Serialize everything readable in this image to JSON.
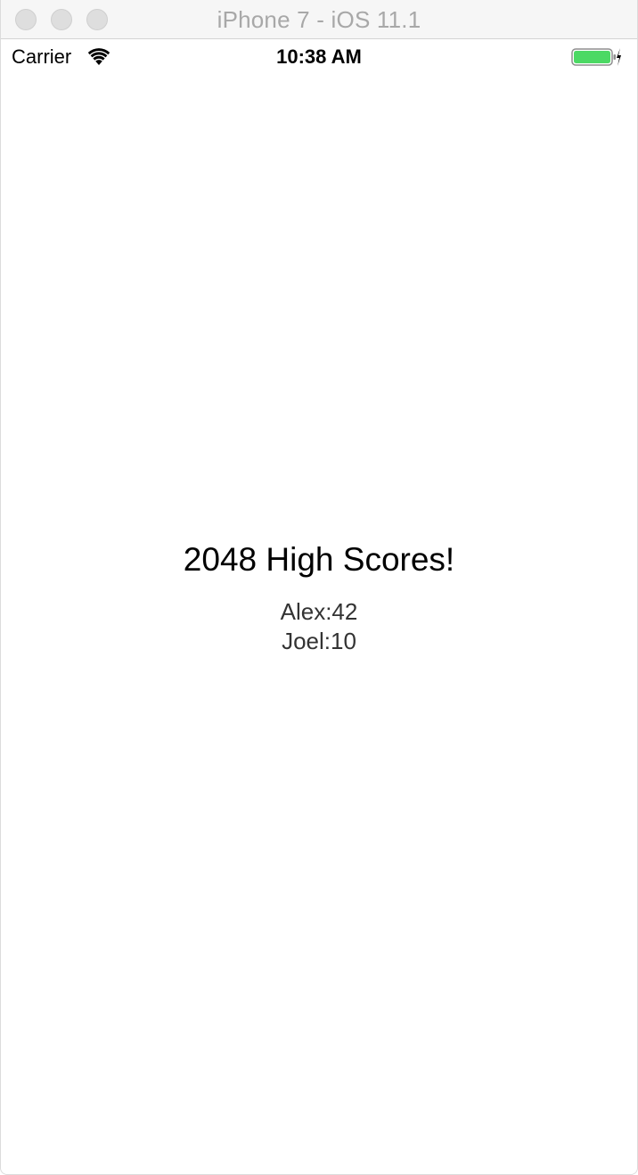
{
  "window": {
    "title": "iPhone 7 - iOS 11.1"
  },
  "status_bar": {
    "carrier": "Carrier",
    "time": "10:38 AM",
    "battery_color": "#4cd964",
    "icons": [
      "wifi-icon",
      "battery-icon",
      "charging-bolt-icon"
    ]
  },
  "main": {
    "heading": "2048 High Scores!",
    "scores": [
      {
        "text": "Alex:42"
      },
      {
        "text": "Joel:10"
      }
    ]
  }
}
